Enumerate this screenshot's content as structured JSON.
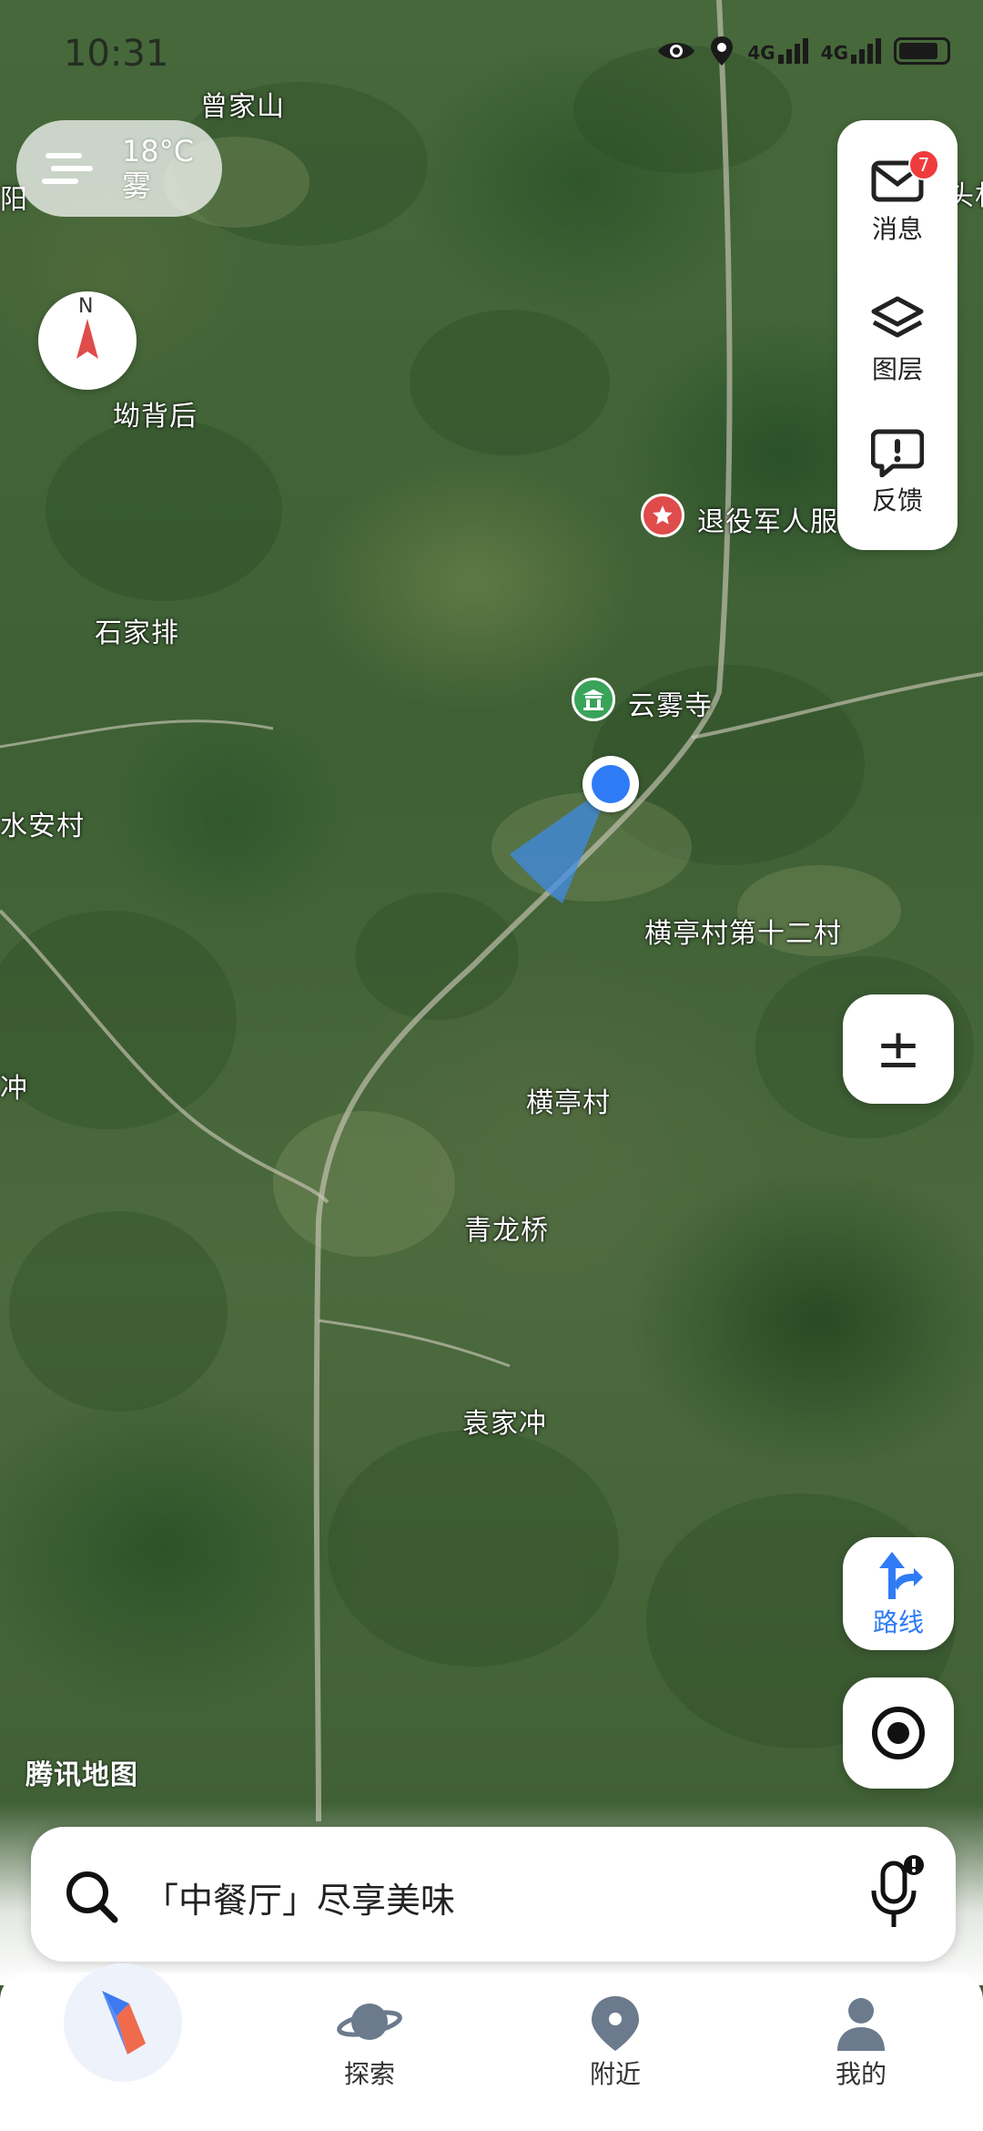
{
  "status_bar": {
    "time": "10:31",
    "network_1": "4G",
    "network_2": "4G"
  },
  "weather": {
    "temperature": "18°C",
    "condition": "雾"
  },
  "compass": {
    "north_label": "N"
  },
  "tools": {
    "messages": {
      "label": "消息",
      "badge": "7"
    },
    "layers": {
      "label": "图层"
    },
    "feedback": {
      "label": "反馈"
    }
  },
  "map_labels": {
    "zengjiashan": "曾家山",
    "aobeihou": "坳背后",
    "shijiapai": "石家排",
    "yonganchun": "水安村",
    "chong_left": "冲",
    "yang_left": "阳",
    "hengtingcun_12": "横亭村第十二村",
    "hengtingcun": "横亭村",
    "qinglongqiao": "青龙桥",
    "yuanjiachong": "袁家冲",
    "edge_top_right": "头林"
  },
  "pois": {
    "veterans": "退役军人服务站",
    "yunwusi": "云雾寺"
  },
  "zoom_button": {
    "label": "±"
  },
  "route_button": {
    "label": "路线"
  },
  "watermark": "腾讯地图",
  "search": {
    "placeholder": "「中餐厅」尽享美味"
  },
  "tabbar": {
    "explore": "探索",
    "nearby": "附近",
    "mine": "我的"
  },
  "colors": {
    "accent": "#2f7bf6",
    "badge": "#ef3b3b",
    "poi_red": "#e04b4b",
    "poi_green": "#3aa35a"
  }
}
